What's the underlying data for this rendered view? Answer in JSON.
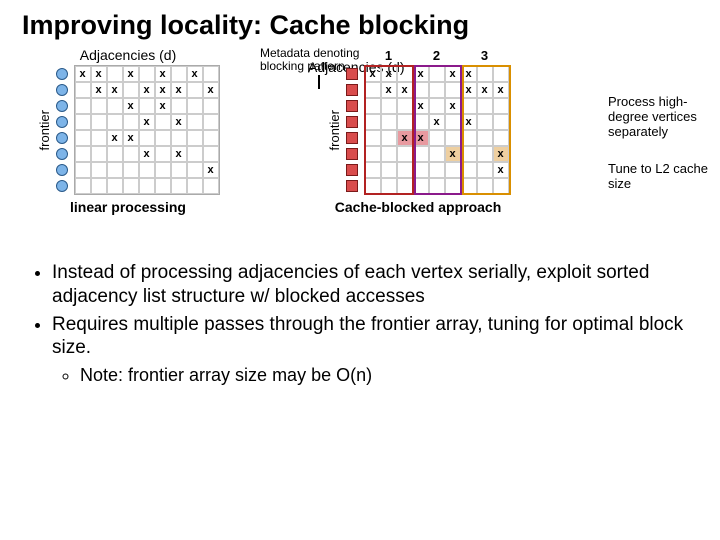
{
  "title": "Improving locality: Cache blocking",
  "left": {
    "adj_label": "Adjacencies (d)",
    "frontier_label": "frontier",
    "caption": "linear processing",
    "grid_rows": 8,
    "grid_cols": 9,
    "marks": [
      [
        0,
        0
      ],
      [
        0,
        1
      ],
      [
        0,
        3
      ],
      [
        0,
        5
      ],
      [
        0,
        7
      ],
      [
        1,
        1
      ],
      [
        1,
        2
      ],
      [
        1,
        4
      ],
      [
        1,
        5
      ],
      [
        1,
        6
      ],
      [
        1,
        8
      ],
      [
        2,
        3
      ],
      [
        2,
        5
      ],
      [
        3,
        4
      ],
      [
        3,
        6
      ],
      [
        4,
        2
      ],
      [
        4,
        3
      ],
      [
        5,
        4
      ],
      [
        5,
        6
      ],
      [
        6,
        8
      ]
    ]
  },
  "right": {
    "adj_label": "Adjacencies (d)",
    "frontier_label": "frontier",
    "caption": "Cache-blocked approach",
    "meta_label": "Metadata denoting blocking pattern",
    "block_labels": [
      "1",
      "2",
      "3"
    ],
    "grid_rows": 8,
    "grid_cols": 9,
    "marks": [
      [
        0,
        0
      ],
      [
        0,
        1
      ],
      [
        0,
        3
      ],
      [
        0,
        5
      ],
      [
        0,
        6
      ],
      [
        1,
        1
      ],
      [
        1,
        2
      ],
      [
        1,
        6
      ],
      [
        1,
        7
      ],
      [
        1,
        8
      ],
      [
        2,
        3
      ],
      [
        2,
        5
      ],
      [
        3,
        4
      ],
      [
        3,
        6
      ],
      [
        4,
        2
      ],
      [
        4,
        3
      ],
      [
        5,
        5
      ],
      [
        5,
        8
      ],
      [
        6,
        8
      ]
    ],
    "highlight_col_cells": [
      [
        4,
        2
      ],
      [
        4,
        3
      ]
    ],
    "highlight_row_cells": [
      [
        5,
        5
      ],
      [
        5,
        8
      ]
    ]
  },
  "notes": {
    "n1": "Process high-degree vertices separately",
    "n2": "Tune to L2 cache size"
  },
  "bullets": {
    "b1": "Instead of processing adjacencies of each vertex serially, exploit sorted adjacency list structure w/ blocked accesses",
    "b2": "Requires multiple passes through the frontier array, tuning for optimal block size.",
    "b2a": "Note: frontier array size may be O(n)"
  }
}
